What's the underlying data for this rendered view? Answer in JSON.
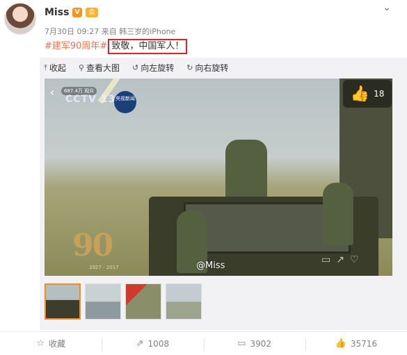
{
  "post": {
    "username": "Miss",
    "verified_badge": "V",
    "level_badge": "会",
    "meta": {
      "time": "7月30日 09:27",
      "source": "来自 韩三岁的iPhone"
    },
    "text": {
      "hashtag": "#建军90周年#",
      "highlighted": "致敬，中国军人！"
    }
  },
  "toolbar": {
    "collapse": "收起",
    "view_large": "查看大图",
    "rotate_left": "向左旋转",
    "rotate_right": "向右旋转"
  },
  "photo": {
    "viewers": "687.4万 观众",
    "channel": "CCTV 13",
    "channel_badge": "央视新闻",
    "logo_number": "90",
    "logo_years": "1927 - 2017",
    "likes": "18",
    "watermark": "@Miss"
  },
  "footer": {
    "favorite": "收藏",
    "reposts": "1008",
    "comments": "3902",
    "likes": "35716"
  },
  "colors": {
    "accent": "#eb7350",
    "highlight_border": "#d8232a",
    "thumb_active_border": "#f08a24"
  }
}
